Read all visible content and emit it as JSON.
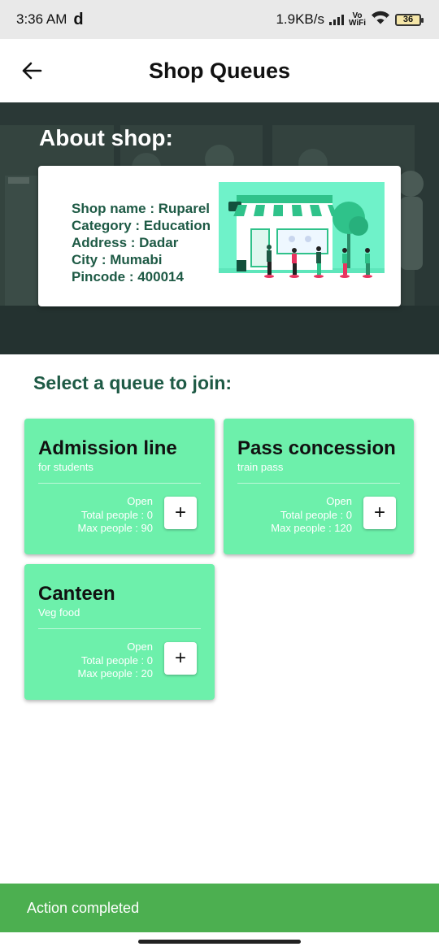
{
  "status_bar": {
    "time": "3:36 AM",
    "carrier_glyph": "d",
    "net_speed": "1.9KB/s",
    "volte_top": "Vo",
    "volte_bottom": "WiFi",
    "battery": "36"
  },
  "app_bar": {
    "title": "Shop Queues",
    "back_icon": "arrow-left-icon"
  },
  "about": {
    "title": "About shop:",
    "shop_name": "Shop name : Ruparel",
    "category": "Category : Education",
    "address": "Address : Dadar",
    "city": "City : Mumabi",
    "pincode": "Pincode : 400014"
  },
  "queues_title": "Select a queue to join:",
  "queues": [
    {
      "name": "Admission line",
      "desc": "for students",
      "status": "Open",
      "total": "Total people : 0",
      "max": "Max people : 90",
      "join_label": "+"
    },
    {
      "name": "Pass concession",
      "desc": "train pass",
      "status": "Open",
      "total": "Total people : 0",
      "max": "Max people : 120",
      "join_label": "+"
    },
    {
      "name": "Canteen",
      "desc": "Veg food",
      "status": "Open",
      "total": "Total people : 0",
      "max": "Max people : 20",
      "join_label": "+"
    }
  ],
  "snackbar": {
    "message": "Action completed"
  },
  "colors": {
    "accent_green": "#6df0ab",
    "dark_green": "#1e5a45",
    "snackbar": "#4caf50",
    "hero_bg": "#2b3a38"
  }
}
